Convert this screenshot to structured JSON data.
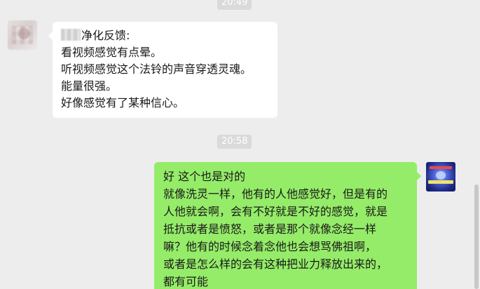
{
  "timestamps": [
    "20:49",
    "20:58"
  ],
  "messages": [
    {
      "side": "left",
      "lines": [
        "净化反馈:",
        "看视频感觉有点晕。",
        "听视频感觉这个法铃的声音穿透灵魂。",
        "能量很强。",
        "好像感觉有了某种信心。"
      ]
    },
    {
      "side": "right",
      "lines": [
        "好 这个也是对的",
        "就像洗灵一样，他有的人他感觉好，但是有的",
        "人他就会啊，会有不好就是不好的感觉，就是",
        "抵抗或者是愤怒，或者是那个就像念经一样",
        "嘛？他有的时候念着念他也会想骂佛祖啊，",
        "或者是怎么样的会有这种把业力释放出来的，",
        "都有可能"
      ]
    }
  ]
}
